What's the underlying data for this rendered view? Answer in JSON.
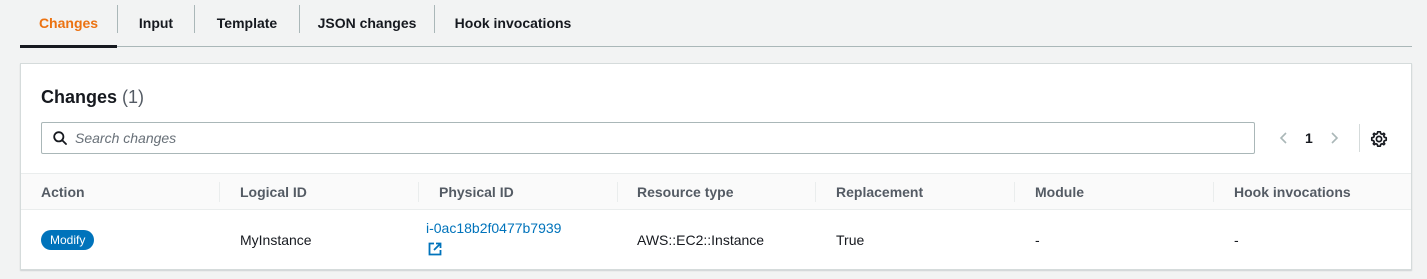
{
  "tabs": [
    {
      "label": "Changes",
      "active": true
    },
    {
      "label": "Input",
      "active": false
    },
    {
      "label": "Template",
      "active": false
    },
    {
      "label": "JSON changes",
      "active": false
    },
    {
      "label": "Hook invocations",
      "active": false
    }
  ],
  "panel": {
    "title": "Changes",
    "count": "(1)"
  },
  "search": {
    "placeholder": "Search changes",
    "value": "",
    "icon": "search-icon"
  },
  "pagination": {
    "current_page": "1",
    "prev_icon": "chevron-left-icon",
    "next_icon": "chevron-right-icon",
    "settings_icon": "gear-icon"
  },
  "table": {
    "columns": [
      "Action",
      "Logical ID",
      "Physical ID",
      "Resource type",
      "Replacement",
      "Module",
      "Hook invocations"
    ],
    "rows": [
      {
        "action": "Modify",
        "logical_id": "MyInstance",
        "physical_id": "i-0ac18b2f0477b7939",
        "physical_id_icon": "external-link-icon",
        "resource_type": "AWS::EC2::Instance",
        "replacement": "True",
        "module": "-",
        "hook_invocations": "-"
      }
    ]
  },
  "colors": {
    "active_tab": "#ec7211",
    "link": "#0073bb",
    "badge_bg": "#0073bb"
  }
}
